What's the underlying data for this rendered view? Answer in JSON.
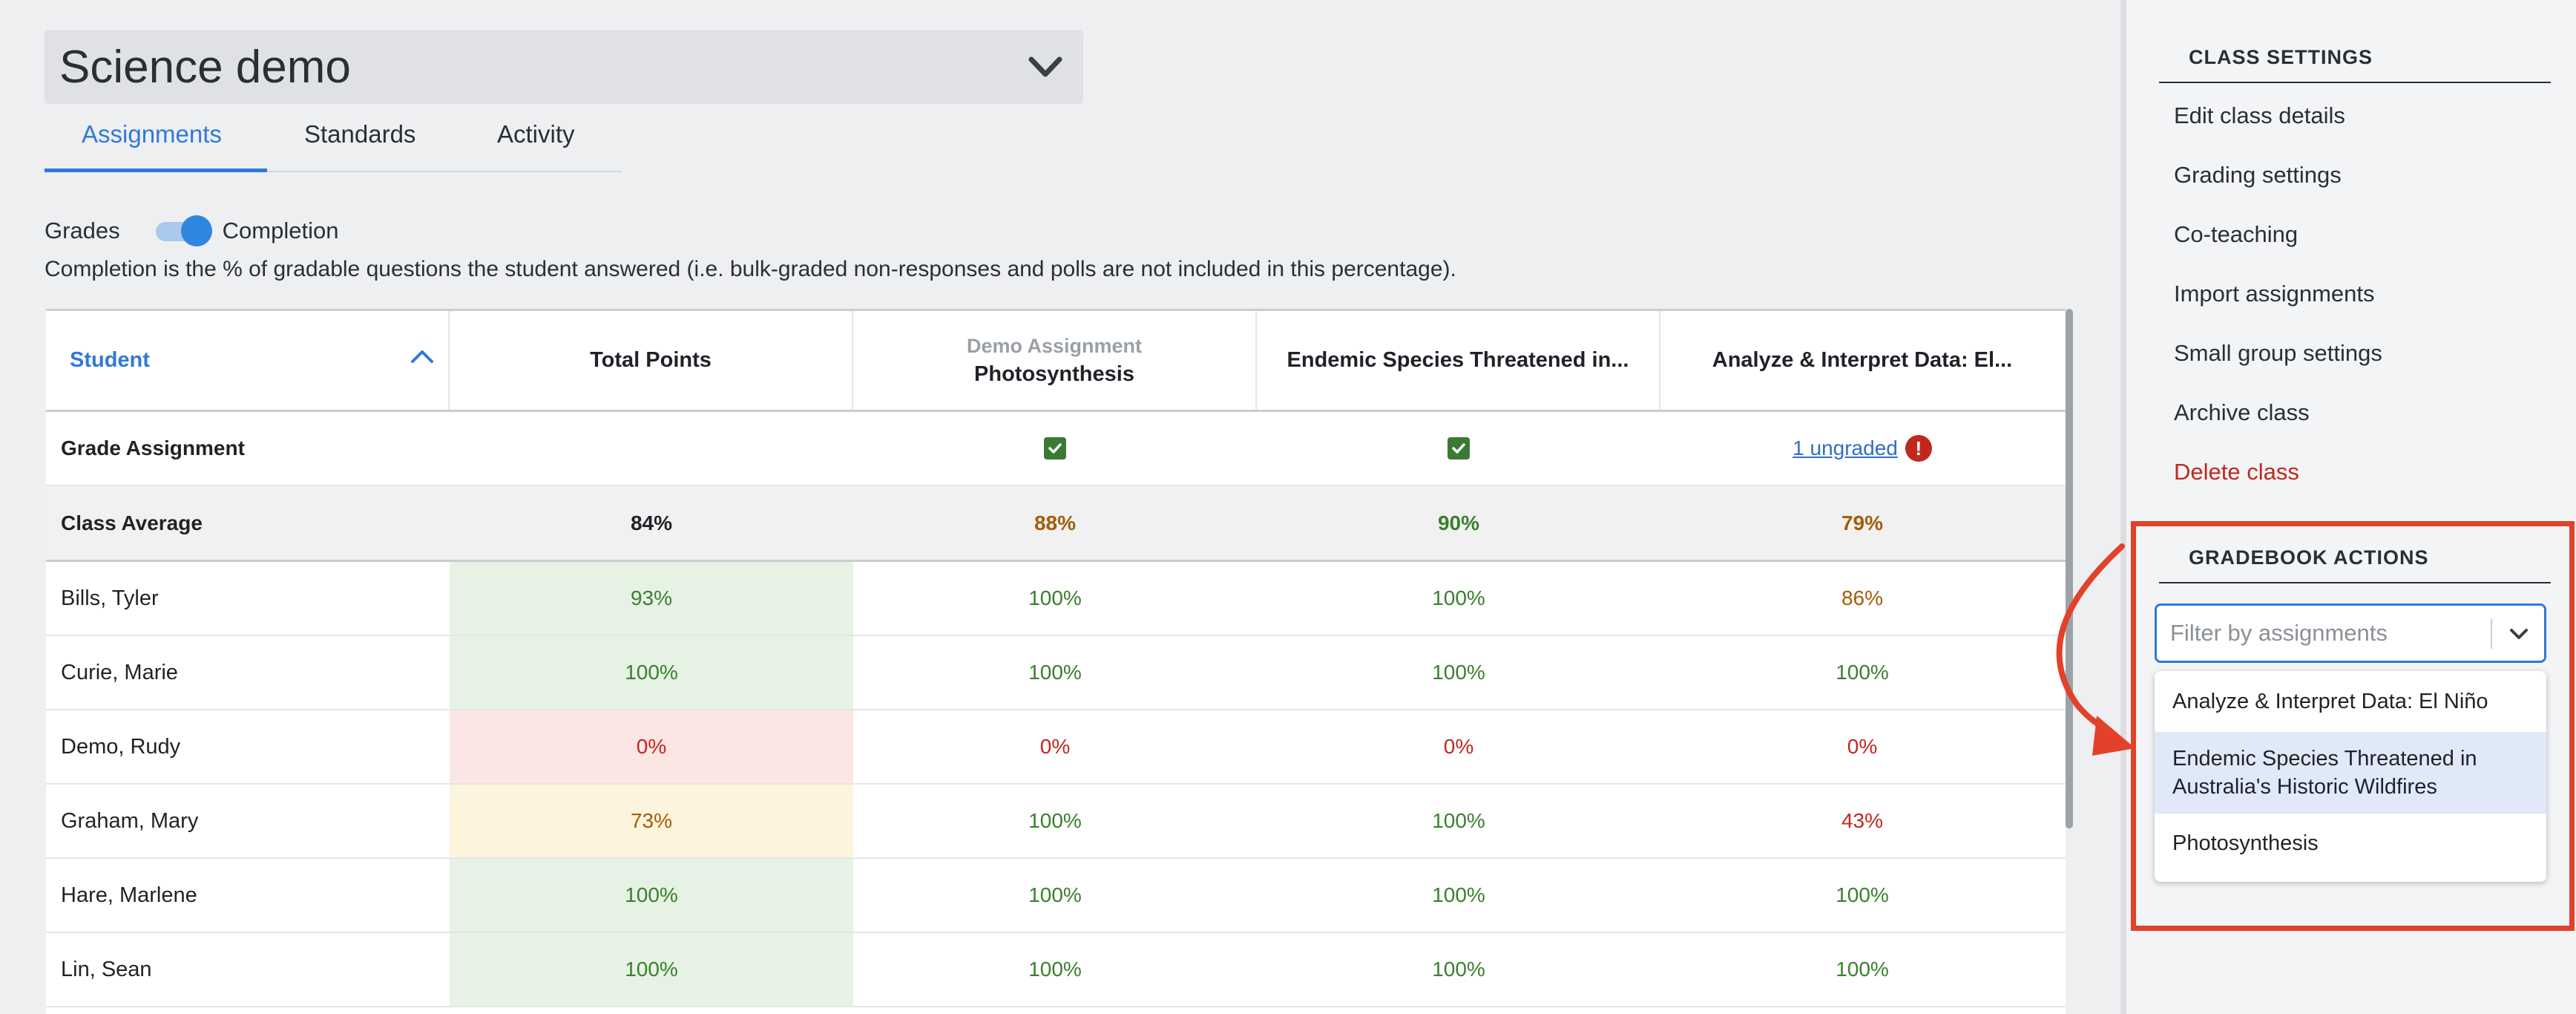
{
  "class_selector": {
    "title": "Science demo"
  },
  "tabs": [
    {
      "label": "Assignments",
      "active": true
    },
    {
      "label": "Standards",
      "active": false
    },
    {
      "label": "Activity",
      "active": false
    }
  ],
  "view_toggle": {
    "left_label": "Grades",
    "right_label": "Completion",
    "selected": "Completion"
  },
  "completion_note": "Completion is the % of gradable questions the student answered (i.e. bulk-graded non-responses and polls are not included in this percentage).",
  "table": {
    "headers": {
      "student": "Student",
      "total": "Total Points",
      "col2_sub": "Demo Assignment",
      "col2": "Photosynthesis",
      "col3": "Endemic Species Threatened in...",
      "col4": "Analyze & Interpret Data: El..."
    },
    "grade_row": {
      "label": "Grade Assignment",
      "col4_link": "1 ungraded",
      "alert_glyph": "!"
    },
    "avg_row": {
      "label": "Class Average",
      "total": "84%",
      "col2": "88%",
      "col3": "90%",
      "col4": "79%"
    },
    "students": [
      {
        "name": "Bills, Tyler",
        "total": "93%",
        "col2": "100%",
        "col3": "100%",
        "col4": "86%"
      },
      {
        "name": "Curie, Marie",
        "total": "100%",
        "col2": "100%",
        "col3": "100%",
        "col4": "100%"
      },
      {
        "name": "Demo, Rudy",
        "total": "0%",
        "col2": "0%",
        "col3": "0%",
        "col4": "0%"
      },
      {
        "name": "Graham, Mary",
        "total": "73%",
        "col2": "100%",
        "col3": "100%",
        "col4": "43%"
      },
      {
        "name": "Hare, Marlene",
        "total": "100%",
        "col2": "100%",
        "col3": "100%",
        "col4": "100%"
      },
      {
        "name": "Lin, Sean",
        "total": "100%",
        "col2": "100%",
        "col3": "100%",
        "col4": "100%"
      }
    ]
  },
  "sidebar": {
    "class_settings": {
      "title": "CLASS SETTINGS",
      "links": [
        "Edit class details",
        "Grading settings",
        "Co-teaching",
        "Import assignments",
        "Small group settings",
        "Archive class",
        "Delete class"
      ]
    },
    "gradebook_actions": {
      "title": "GRADEBOOK ACTIONS",
      "filter_placeholder": "Filter by assignments",
      "options": [
        {
          "line1": "Analyze & Interpret Data: El Niño",
          "line2": ""
        },
        {
          "line1": "Endemic Species Threatened in",
          "line2": "Australia's Historic Wildfires"
        },
        {
          "line1": "Photosynthesis",
          "line2": ""
        }
      ]
    }
  },
  "colors": {
    "accent": "#2f7ad6",
    "danger": "#c0281e",
    "good": "#3a7f2e",
    "warn": "#a25d08",
    "highlight": "#e2412a"
  }
}
